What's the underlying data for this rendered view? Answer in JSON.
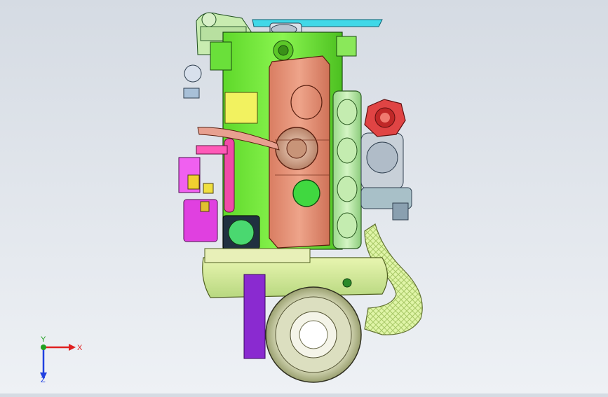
{
  "viewport": {
    "background_top": "#d5dbe3",
    "background_bottom": "#eef1f5",
    "model": "engine-assembly"
  },
  "triad": {
    "x_label": "X",
    "y_label": "Y",
    "z_label": "Z",
    "x_color": "#e02020",
    "y_color": "#20a020",
    "z_color": "#2040e0"
  },
  "colors": {
    "block": "#7cf03c",
    "head_cover": "#e8957a",
    "manifold": "#b8e8a8",
    "turbo_flange": "#e04040",
    "intake_hose": "#d8f0a0",
    "pulley": "#eef0d8",
    "belt": "#8a2ad0",
    "fuel_rail": "#f04aa8",
    "cover_plate": "#f0f060",
    "magenta_pump": "#e040e0",
    "ac_plate": "#40d0e0"
  }
}
